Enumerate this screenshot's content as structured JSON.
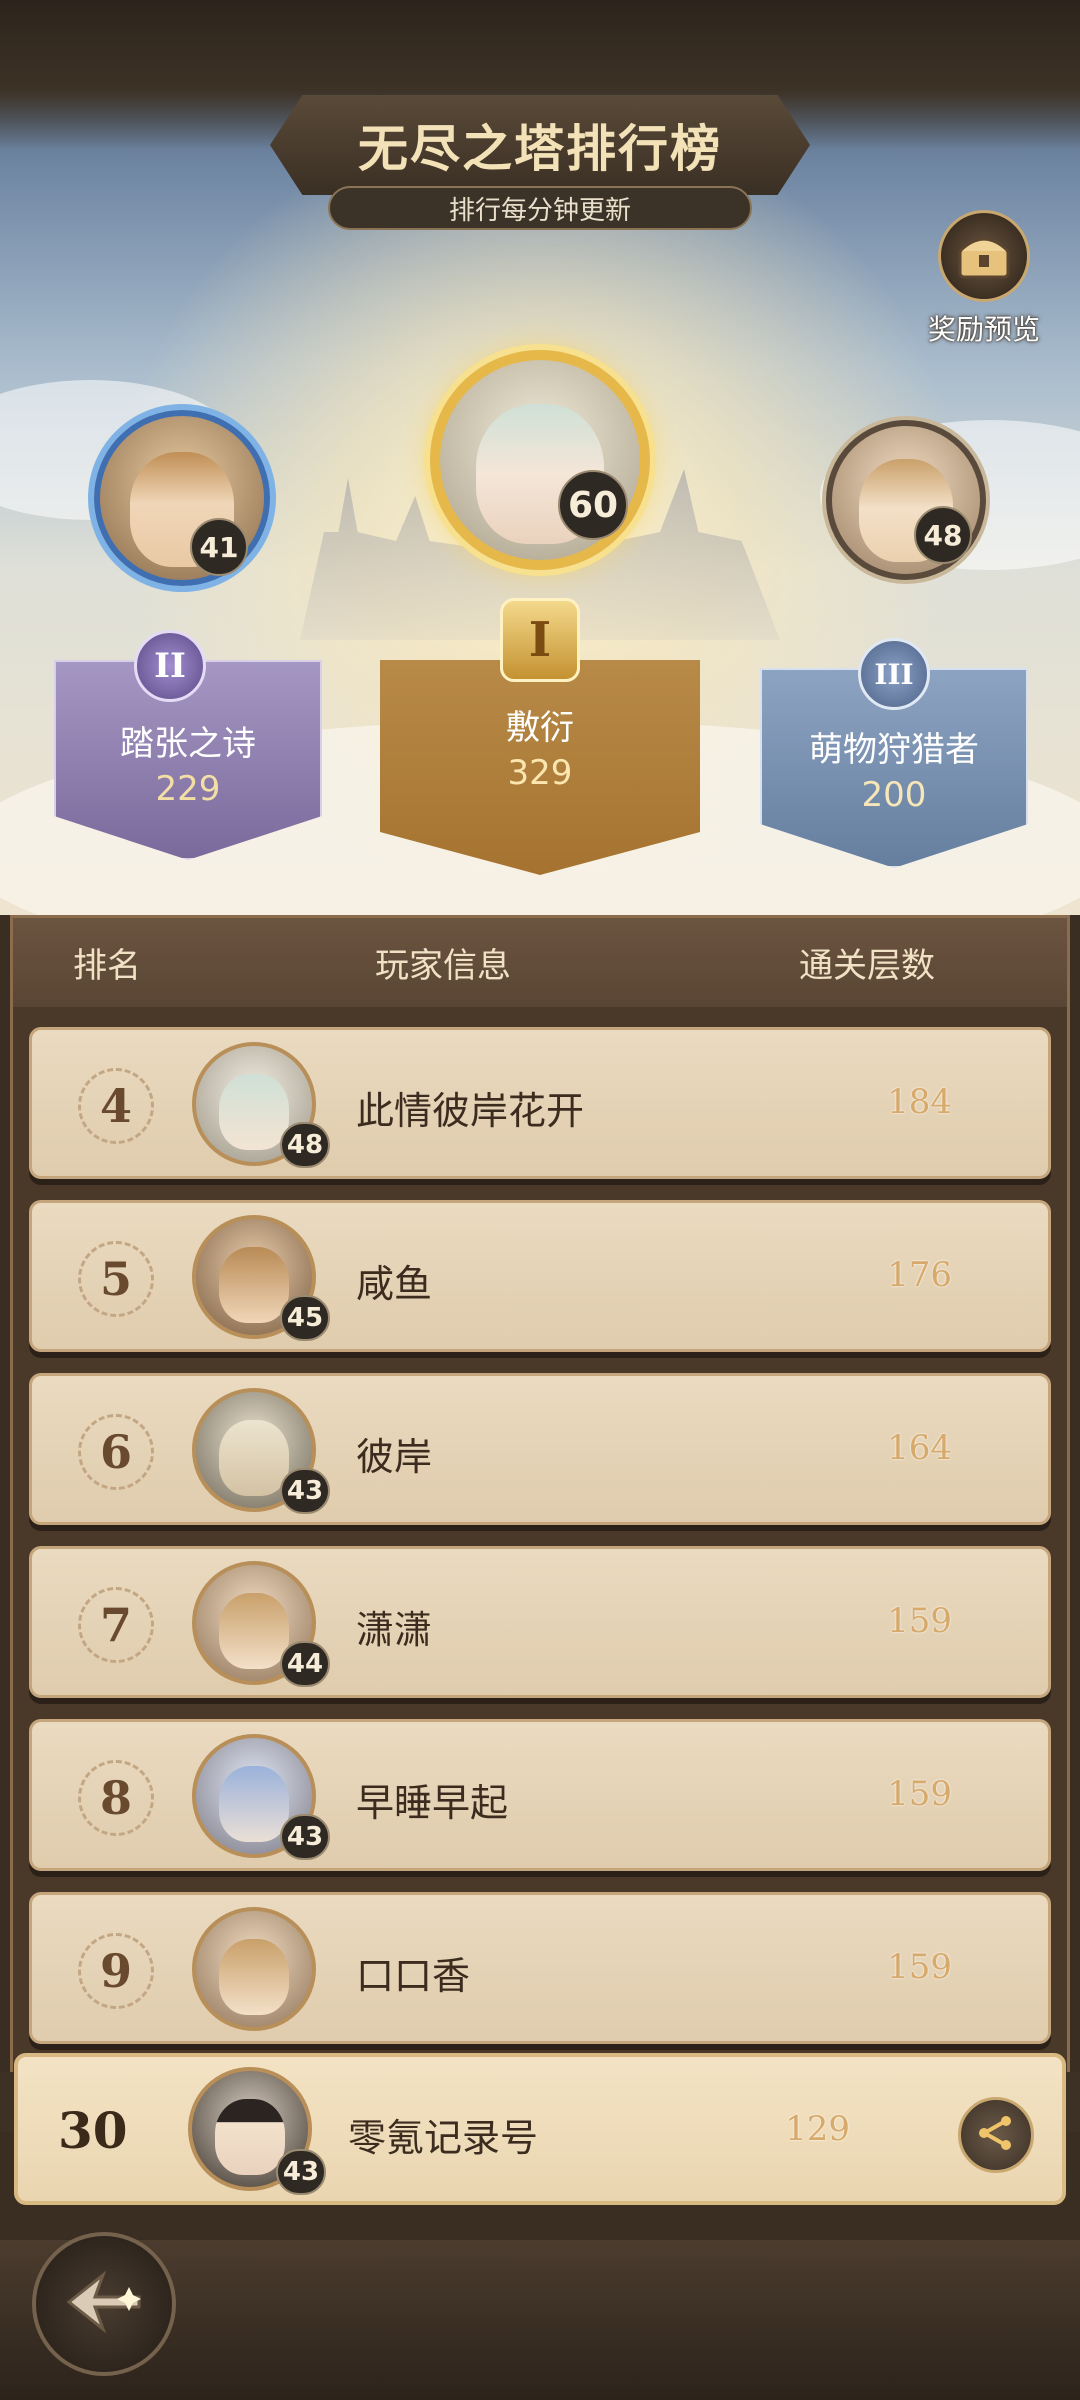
{
  "header": {
    "title": "无尽之塔排行榜",
    "subtitle": "排行每分钟更新",
    "reward_label": "奖励预览"
  },
  "podium": {
    "first": {
      "rank": "I",
      "name": "敷衍",
      "score": "329",
      "level": "60"
    },
    "second": {
      "rank": "II",
      "name": "踏张之诗",
      "score": "229",
      "level": "41"
    },
    "third": {
      "rank": "III",
      "name": "萌物狩猎者",
      "score": "200",
      "level": "48"
    }
  },
  "table": {
    "columns": [
      "排名",
      "玩家信息",
      "通关层数"
    ],
    "rows": [
      {
        "rank": "4",
        "name": "此情彼岸花开",
        "level": "48",
        "score": "184"
      },
      {
        "rank": "5",
        "name": "咸鱼",
        "level": "45",
        "score": "176"
      },
      {
        "rank": "6",
        "name": "彼岸",
        "level": "43",
        "score": "164"
      },
      {
        "rank": "7",
        "name": "潇潇",
        "level": "44",
        "score": "159"
      },
      {
        "rank": "8",
        "name": "早睡早起",
        "level": "43",
        "score": "159"
      },
      {
        "rank": "9",
        "name": "口口香",
        "level": "",
        "score": "159"
      }
    ]
  },
  "self": {
    "rank": "30",
    "name": "零氪记录号",
    "level": "43",
    "score": "129"
  },
  "colors": {
    "gold": "#d7a96a",
    "parchment": "#e6d4b6",
    "dark_brown": "#3a2d22",
    "silver_purple": "#8a7aa8",
    "bronze_blue": "#6f84a6"
  },
  "icons": {
    "reward": "treasure-chest-icon",
    "share": "share-icon",
    "back": "back-arrow-icon"
  }
}
